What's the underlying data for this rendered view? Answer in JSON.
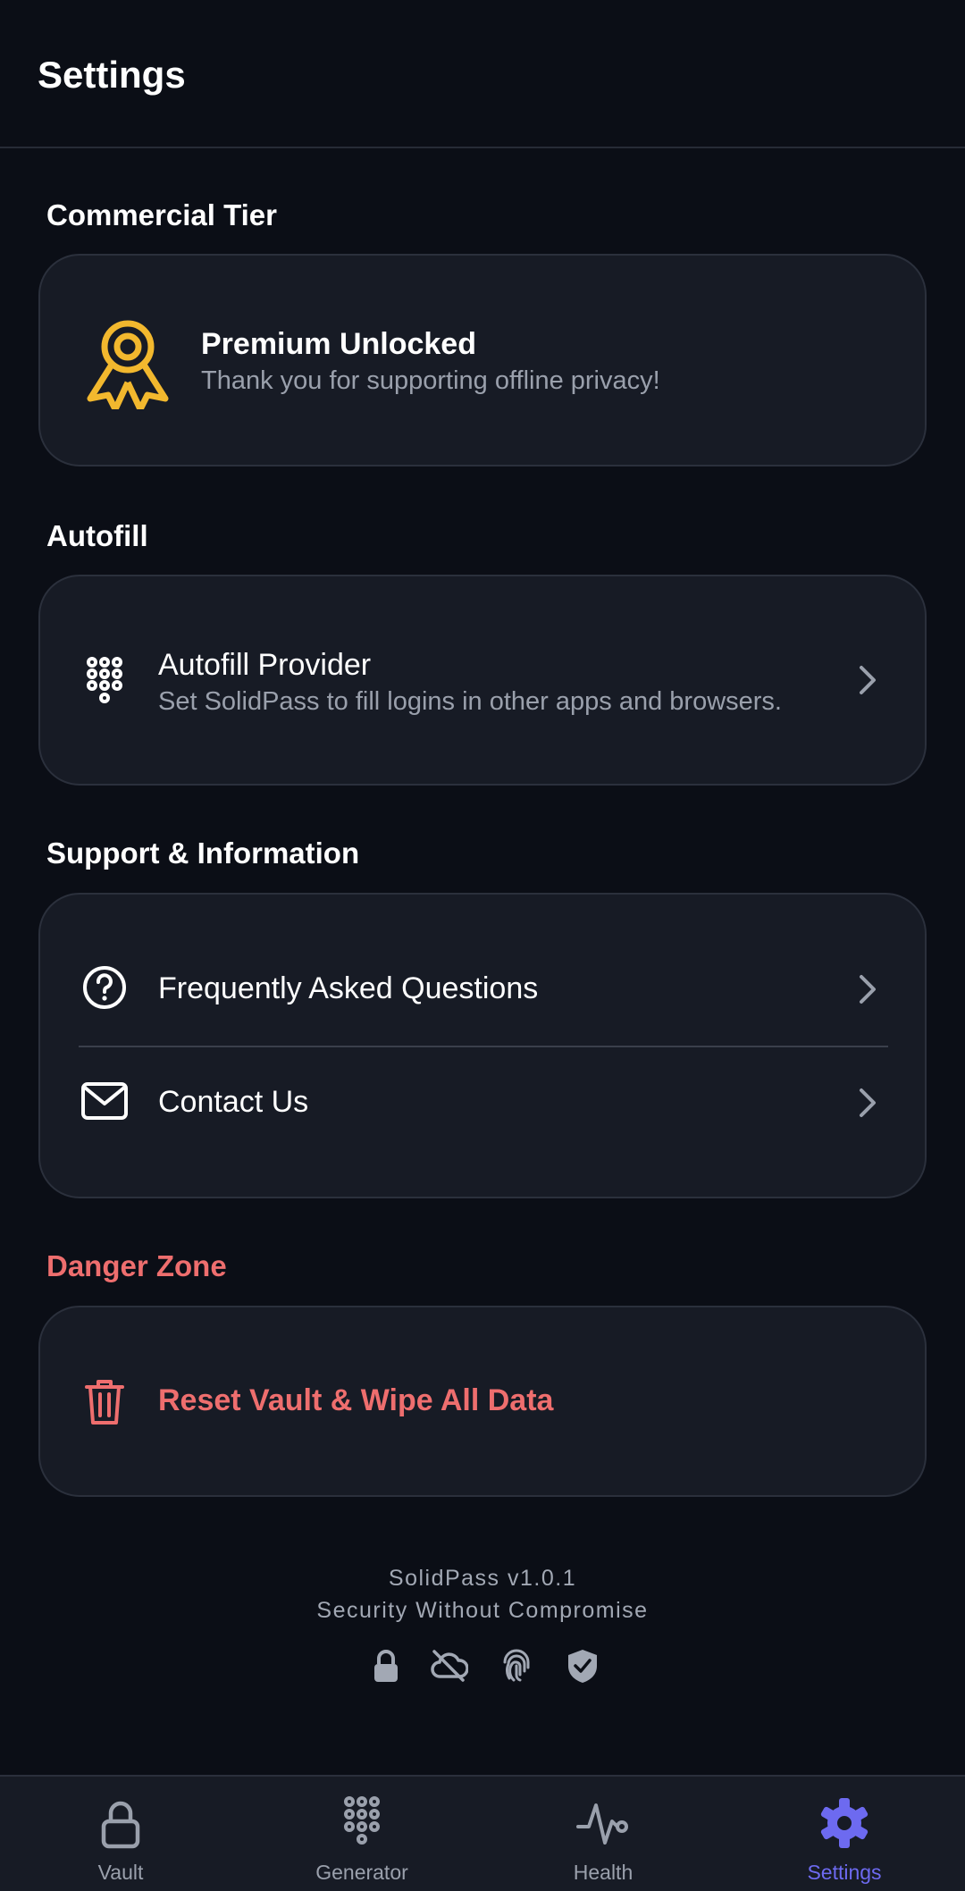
{
  "header": {
    "title": "Settings"
  },
  "sections": {
    "commercial": {
      "title": "Commercial Tier"
    },
    "autofill": {
      "title": "Autofill"
    },
    "support": {
      "title": "Support & Information"
    },
    "danger": {
      "title": "Danger Zone"
    }
  },
  "premium": {
    "icon": "award-ribbon-icon",
    "title": "Premium Unlocked",
    "subtitle": "Thank you for supporting offline privacy!"
  },
  "autofill_provider": {
    "icon": "dialpad-icon",
    "label": "Autofill Provider",
    "subtitle": "Set SolidPass to fill logins in other apps and browsers."
  },
  "support_items": [
    {
      "icon": "help-circle-icon",
      "label": "Frequently Asked Questions"
    },
    {
      "icon": "mail-icon",
      "label": "Contact Us"
    }
  ],
  "danger_item": {
    "icon": "trash-icon",
    "label": "Reset Vault & Wipe All Data"
  },
  "footer": {
    "version": "SolidPass v1.0.1",
    "tagline": "Security Without Compromise",
    "badges": [
      "lock-icon",
      "cloud-off-icon",
      "fingerprint-icon",
      "shield-check-icon"
    ]
  },
  "bottom_nav": {
    "items": [
      {
        "label": "Vault",
        "icon": "lock-icon"
      },
      {
        "label": "Generator",
        "icon": "dialpad-icon"
      },
      {
        "label": "Health",
        "icon": "pulse-icon"
      },
      {
        "label": "Settings",
        "icon": "gear-icon",
        "active": true
      }
    ]
  },
  "colors": {
    "background": "#0b0e16",
    "card": "#171b25",
    "accent": "#6d6af0",
    "danger": "#ee6e6e",
    "gold": "#f2b82e",
    "muted": "#9aa0ac"
  }
}
